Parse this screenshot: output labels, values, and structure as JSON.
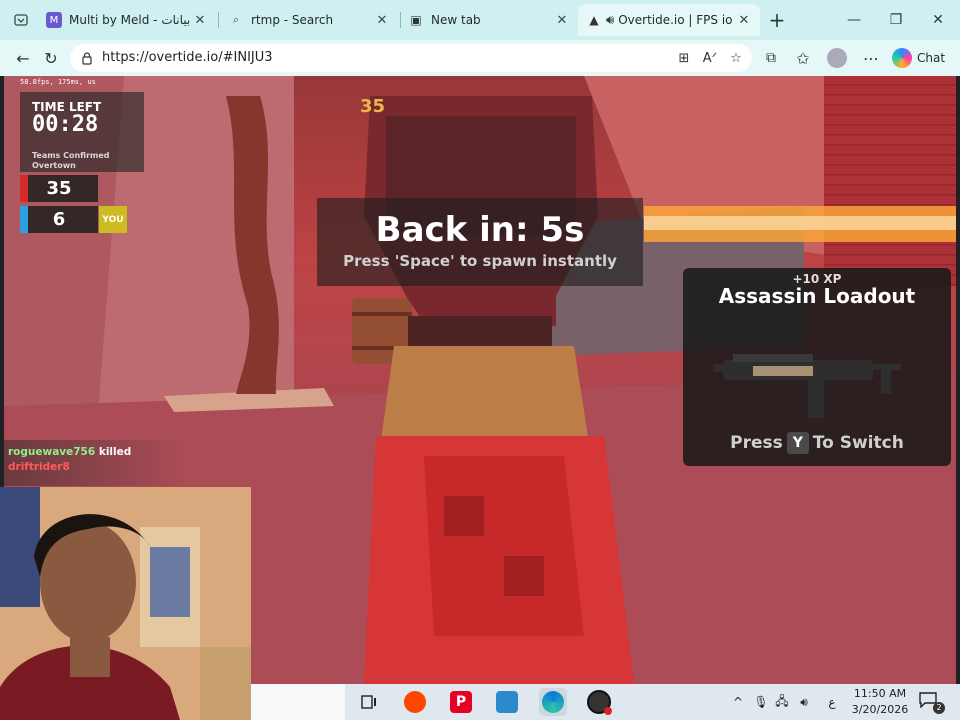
{
  "browser": {
    "tabs": [
      {
        "title": "Multi by Meld - جة بيانات",
        "active": false,
        "favicon": "meld-favicon",
        "favicon_text": "M",
        "favicon_color": "#6a5acd"
      },
      {
        "title": "rtmp - Search",
        "active": false,
        "favicon": "search-icon",
        "favicon_text": "🔍",
        "favicon_color": "#ffffff"
      },
      {
        "title": "New tab",
        "active": false,
        "favicon": "newtab-icon",
        "favicon_text": "▣",
        "favicon_color": "#ffffff"
      },
      {
        "title": "Overtide.io | FPS io G",
        "active": true,
        "favicon": "overtide-favicon",
        "favicon_text": "▲",
        "favicon_color": "#333333",
        "audio": true
      }
    ],
    "url": "https://overtide.io/#INIJU3",
    "chat_label": "Chat",
    "accent_color": "#cfeff0"
  },
  "game": {
    "perf_text": "58.8fps, 175ms, us",
    "timer_label": "TIME LEFT",
    "timer_value": "00:28",
    "mode_line1": "Teams Confirmed",
    "mode_line2": "Overtown",
    "team_scores": [
      {
        "value": "35",
        "color": "#d42a2a"
      },
      {
        "value": "6",
        "color": "#2aa0e0"
      }
    ],
    "you_badge": "YOU",
    "top_counter": "35",
    "kill_feed": {
      "killer": "roguewave756",
      "verb": "killed",
      "victim": "driftrider8"
    },
    "respawn_title": "Back in: 5s",
    "respawn_hint": "Press 'Space' to spawn instantly",
    "loadout": {
      "xp": "+10 XP",
      "name": "Assassin Loadout",
      "press_label": "Press",
      "key": "Y",
      "switch_label": "To Switch"
    }
  },
  "taskbar": {
    "apps": [
      "task-view-icon",
      "reddit-icon",
      "pinterest-icon",
      "game-app-icon",
      "edge-icon",
      "obs-icon"
    ],
    "tray": {
      "chevron": "^",
      "lang": "ع",
      "time": "11:50 AM",
      "date": "3/20/2026",
      "notifications": "2"
    }
  }
}
